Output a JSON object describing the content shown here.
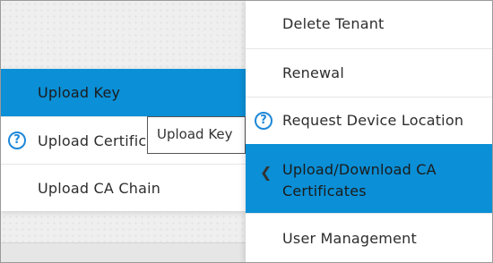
{
  "submenu": {
    "items": [
      {
        "label": "Upload Key",
        "active": true
      },
      {
        "label": "Upload Certificate",
        "help_icon": "question-circle-icon"
      },
      {
        "label": "Upload CA Chain"
      }
    ]
  },
  "tooltip": {
    "text": "Upload Key"
  },
  "main_menu": {
    "items": [
      {
        "label": "Delete Tenant"
      },
      {
        "label": "Renewal"
      },
      {
        "label": "Request Device Location",
        "help_icon": "question-circle-icon"
      },
      {
        "label": "Upload/Download CA Certificates",
        "active": true,
        "icon": "chevron-left-icon"
      },
      {
        "label": "User Management"
      }
    ]
  },
  "colors": {
    "accent": "#0b8fd6",
    "help_icon": "#1e88d9"
  }
}
